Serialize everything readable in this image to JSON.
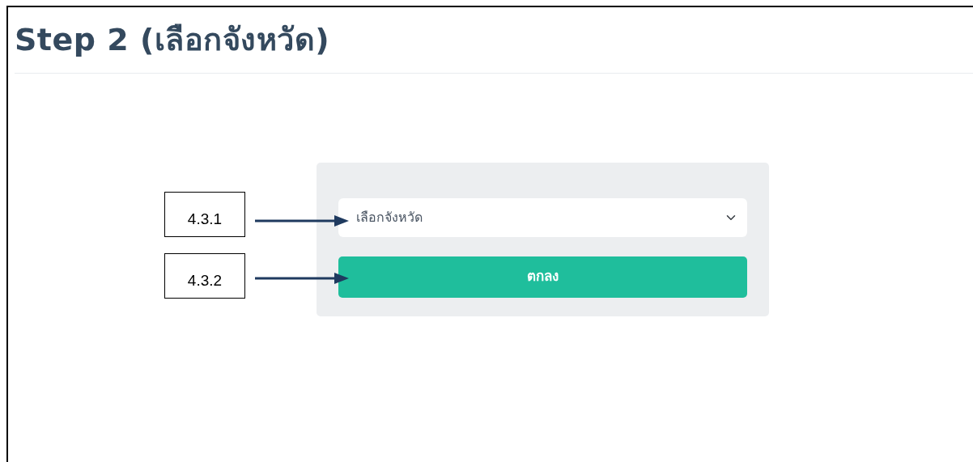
{
  "page": {
    "title": "Step 2 (เลือกจังหวัด)"
  },
  "province_select": {
    "value": "เลือกจังหวัด"
  },
  "submit_button": {
    "label": "ตกลง"
  },
  "callouts": [
    {
      "label": "4.3.1"
    },
    {
      "label": "4.3.2"
    }
  ]
}
